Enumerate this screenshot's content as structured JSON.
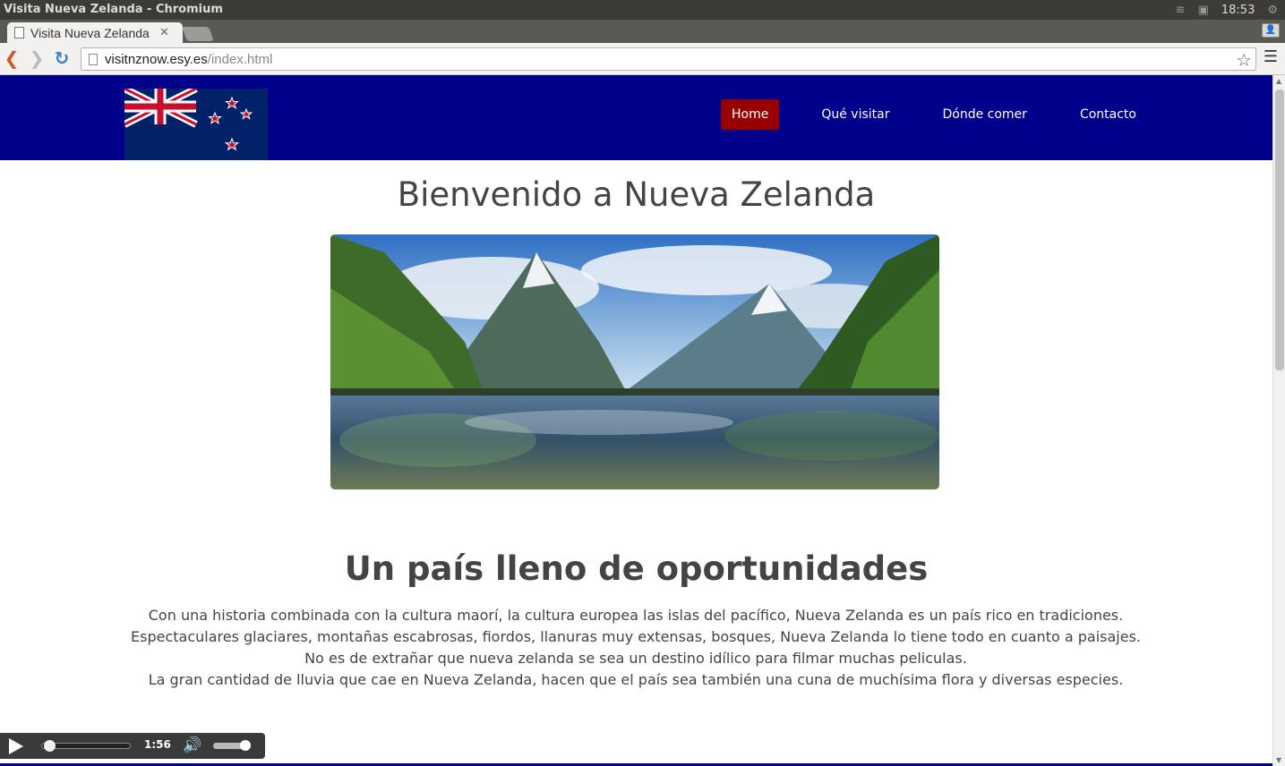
{
  "window": {
    "title": "Visita Nueva Zelanda - Chromium",
    "clock": "18:53",
    "tray_icons": [
      "wifi-icon",
      "keyboard-icon",
      "gear-icon"
    ]
  },
  "tab": {
    "title": "Visita Nueva Zelanda",
    "close": "✕"
  },
  "toolbar": {
    "url_host": "visitnznow.esy.es",
    "url_path": "/index.html",
    "profile": "👤"
  },
  "site": {
    "nav": [
      {
        "label": "Home",
        "active": true
      },
      {
        "label": "Qué visitar",
        "active": false
      },
      {
        "label": "Dónde comer",
        "active": false
      },
      {
        "label": "Contacto",
        "active": false
      }
    ],
    "title": "Bienvenido a Nueva Zelanda",
    "section_title": "Un país lleno de oportunidades",
    "paragraph_lines": [
      "Con una historia combinada con la cultura maorí, la cultura europea las islas del pacífico, Nueva Zelanda es un país rico en tradiciones.",
      "Espectaculares glaciares, montañas escabrosas, fiordos, llanuras muy extensas, bosques, Nueva Zelanda lo tiene todo en cuanto a paisajes. No es de extrañar que nueva zelanda se sea un destino idílico para filmar muchas peliculas.",
      "La gran cantidad de lluvia que cae en Nueva Zelanda, hacen que el país sea también una cuna de muchísima flora y diversas especies."
    ]
  },
  "player": {
    "time": "1:56",
    "progress": 0.05,
    "volume": 0.85
  },
  "colors": {
    "header_bg": "#00008a",
    "nav_active": "#990000",
    "text": "#444444"
  }
}
